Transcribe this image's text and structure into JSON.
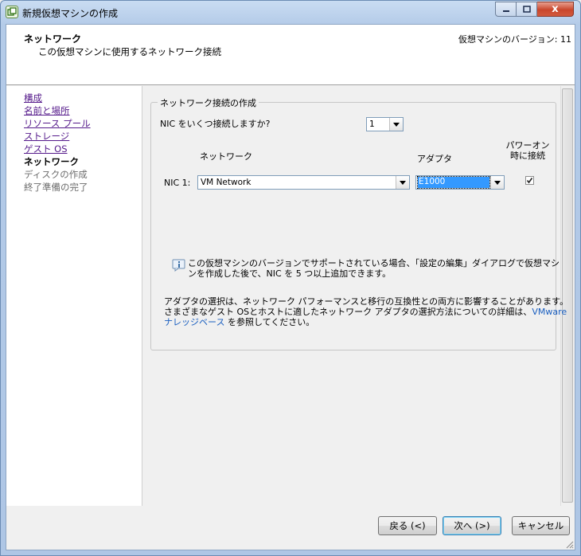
{
  "window": {
    "title": "新規仮想マシンの作成",
    "close_glyph": "x"
  },
  "header": {
    "title": "ネットワーク",
    "subtitle": "この仮想マシンに使用するネットワーク接続",
    "version": "仮想マシンのバージョン: 11"
  },
  "nav": {
    "items": [
      {
        "label": "構成",
        "state": "done"
      },
      {
        "label": "名前と場所",
        "state": "done"
      },
      {
        "label": "リソース プール",
        "state": "done"
      },
      {
        "label": "ストレージ",
        "state": "done"
      },
      {
        "label": "ゲスト OS",
        "state": "done"
      },
      {
        "label": "ネットワーク",
        "state": "current"
      },
      {
        "label": "ディスクの作成",
        "state": "pending"
      },
      {
        "label": "終了準備の完了",
        "state": "pending"
      }
    ]
  },
  "group": {
    "legend": "ネットワーク接続の作成",
    "nic_count_question": "NIC をいくつ接続しますか?",
    "nic_count_value": "1",
    "col_network": "ネットワーク",
    "col_adapter": "アダプタ",
    "col_power_on_line1": "パワーオン",
    "col_power_on_line2": "時に接続",
    "nic1_label": "NIC 1:",
    "nic1_network": "VM Network",
    "nic1_adapter": "E1000",
    "nic1_connect_at_power_on": true,
    "info_line1": "この仮想マシンのバージョンでサポートされている場合、「設定の編集」ダイアログで仮想マシ",
    "info_line2": "ンを作成した後で、NIC を 5 つ以上追加できます。",
    "adapter_line1": "アダプタの選択は、ネットワーク パフォーマンスと移行の互換性との両方に影響することがあります。",
    "adapter_line2_text": "さまざまなゲスト OSとホストに適したネットワーク アダプタの選択方法についての詳細は、",
    "adapter_line2_link": "VMware",
    "adapter_line3_link": "ナレッジベース",
    "adapter_line3_text": " を参照してください。"
  },
  "buttons": {
    "back": "戻る (<)",
    "next": "次へ (>)",
    "cancel": "キャンセル"
  },
  "colors": {
    "link": "#551a8b",
    "selection": "#3399ff",
    "kb_link": "#1a5fc0"
  }
}
